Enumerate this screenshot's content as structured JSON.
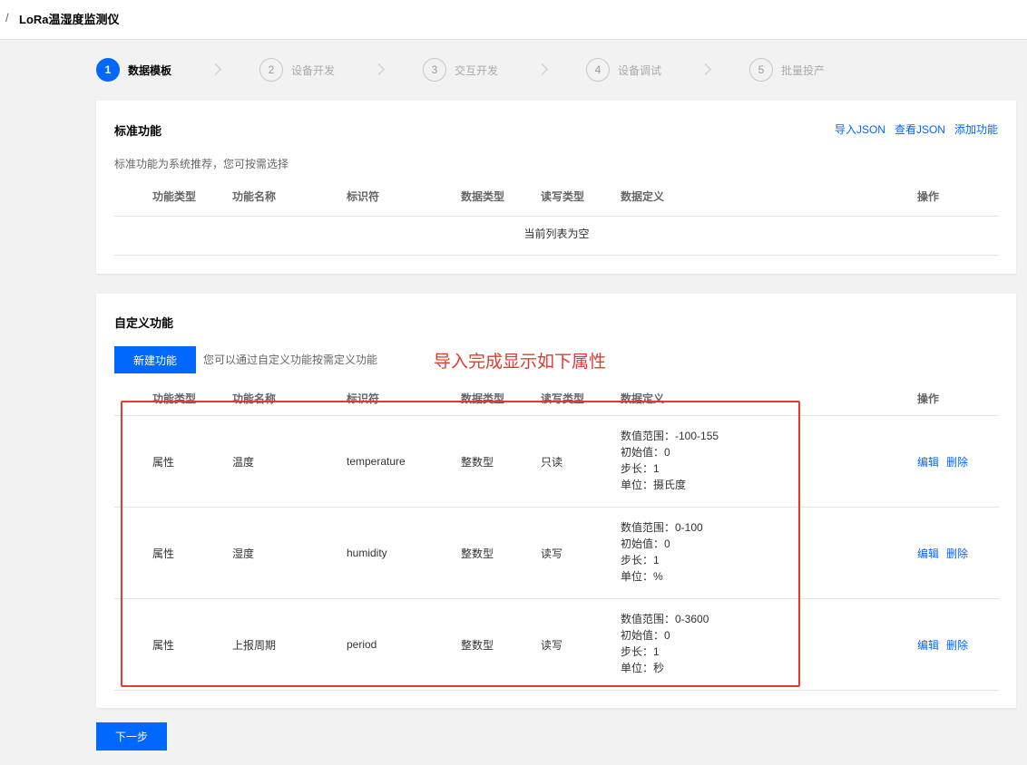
{
  "breadcrumb": {
    "separator": "/",
    "title": "LoRa温湿度监测仪"
  },
  "steps": [
    {
      "num": "1",
      "label": "数据模板",
      "active": true
    },
    {
      "num": "2",
      "label": "设备开发",
      "active": false
    },
    {
      "num": "3",
      "label": "交互开发",
      "active": false
    },
    {
      "num": "4",
      "label": "设备调试",
      "active": false
    },
    {
      "num": "5",
      "label": "批量投产",
      "active": false
    }
  ],
  "standard": {
    "title": "标准功能",
    "desc": "标准功能为系统推荐，您可按需选择",
    "actions": {
      "import_json": "导入JSON",
      "view_json": "查看JSON",
      "add": "添加功能"
    },
    "empty_text": "当前列表为空"
  },
  "columns": {
    "type": "功能类型",
    "name": "功能名称",
    "identifier": "标识符",
    "data_type": "数据类型",
    "rw": "读写类型",
    "definition": "数据定义",
    "ops": "操作"
  },
  "custom": {
    "title": "自定义功能",
    "new_button": "新建功能",
    "hint": "您可以通过自定义功能按需定义功能",
    "annotation": "导入完成显示如下属性",
    "rows": [
      {
        "type": "属性",
        "name": "温度",
        "identifier": "temperature",
        "data_type": "整数型",
        "rw": "只读",
        "def": [
          "数值范围：-100-155",
          "初始值：0",
          "步长：1",
          "单位：摄氏度"
        ],
        "edit": "编辑",
        "delete": "删除"
      },
      {
        "type": "属性",
        "name": "湿度",
        "identifier": "humidity",
        "data_type": "整数型",
        "rw": "读写",
        "def": [
          "数值范围：0-100",
          "初始值：0",
          "步长：1",
          "单位：%"
        ],
        "edit": "编辑",
        "delete": "删除"
      },
      {
        "type": "属性",
        "name": "上报周期",
        "identifier": "period",
        "data_type": "整数型",
        "rw": "读写",
        "def": [
          "数值范围：0-3600",
          "初始值：0",
          "步长：1",
          "单位：秒"
        ],
        "edit": "编辑",
        "delete": "删除"
      }
    ]
  },
  "next_button": "下一步",
  "colors": {
    "primary": "#0067ff",
    "annotation": "#e23b2e"
  }
}
